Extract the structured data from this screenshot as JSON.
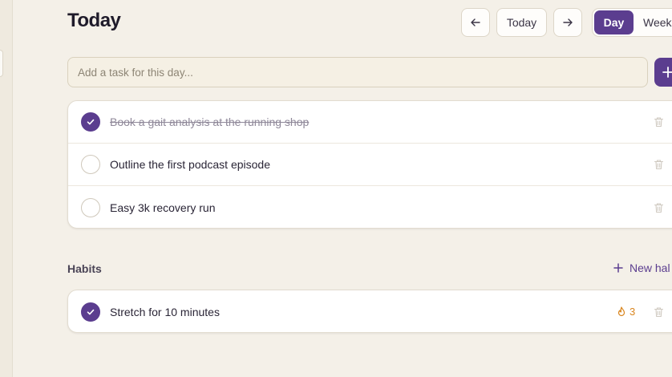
{
  "header": {
    "title": "Today",
    "prev_icon": "arrow-left-icon",
    "today_label": "Today",
    "next_icon": "arrow-right-icon",
    "view_day": "Day",
    "view_week": "Week"
  },
  "add_task": {
    "placeholder": "Add a task for this day...",
    "value": "",
    "button_icon": "plus-icon"
  },
  "tasks": [
    {
      "label": "Book a gait analysis at the running shop",
      "done": true
    },
    {
      "label": "Outline the first podcast episode",
      "done": false
    },
    {
      "label": "Easy 3k recovery run",
      "done": false
    }
  ],
  "habits": {
    "section_label": "Habits",
    "new_label": "New hal",
    "items": [
      {
        "label": "Stretch for 10 minutes",
        "done": true,
        "streak": "3",
        "streak_icon": "flame-icon"
      }
    ]
  },
  "colors": {
    "accent": "#5b3d8f",
    "background": "#f4f0e8",
    "streak": "#d9861f"
  }
}
